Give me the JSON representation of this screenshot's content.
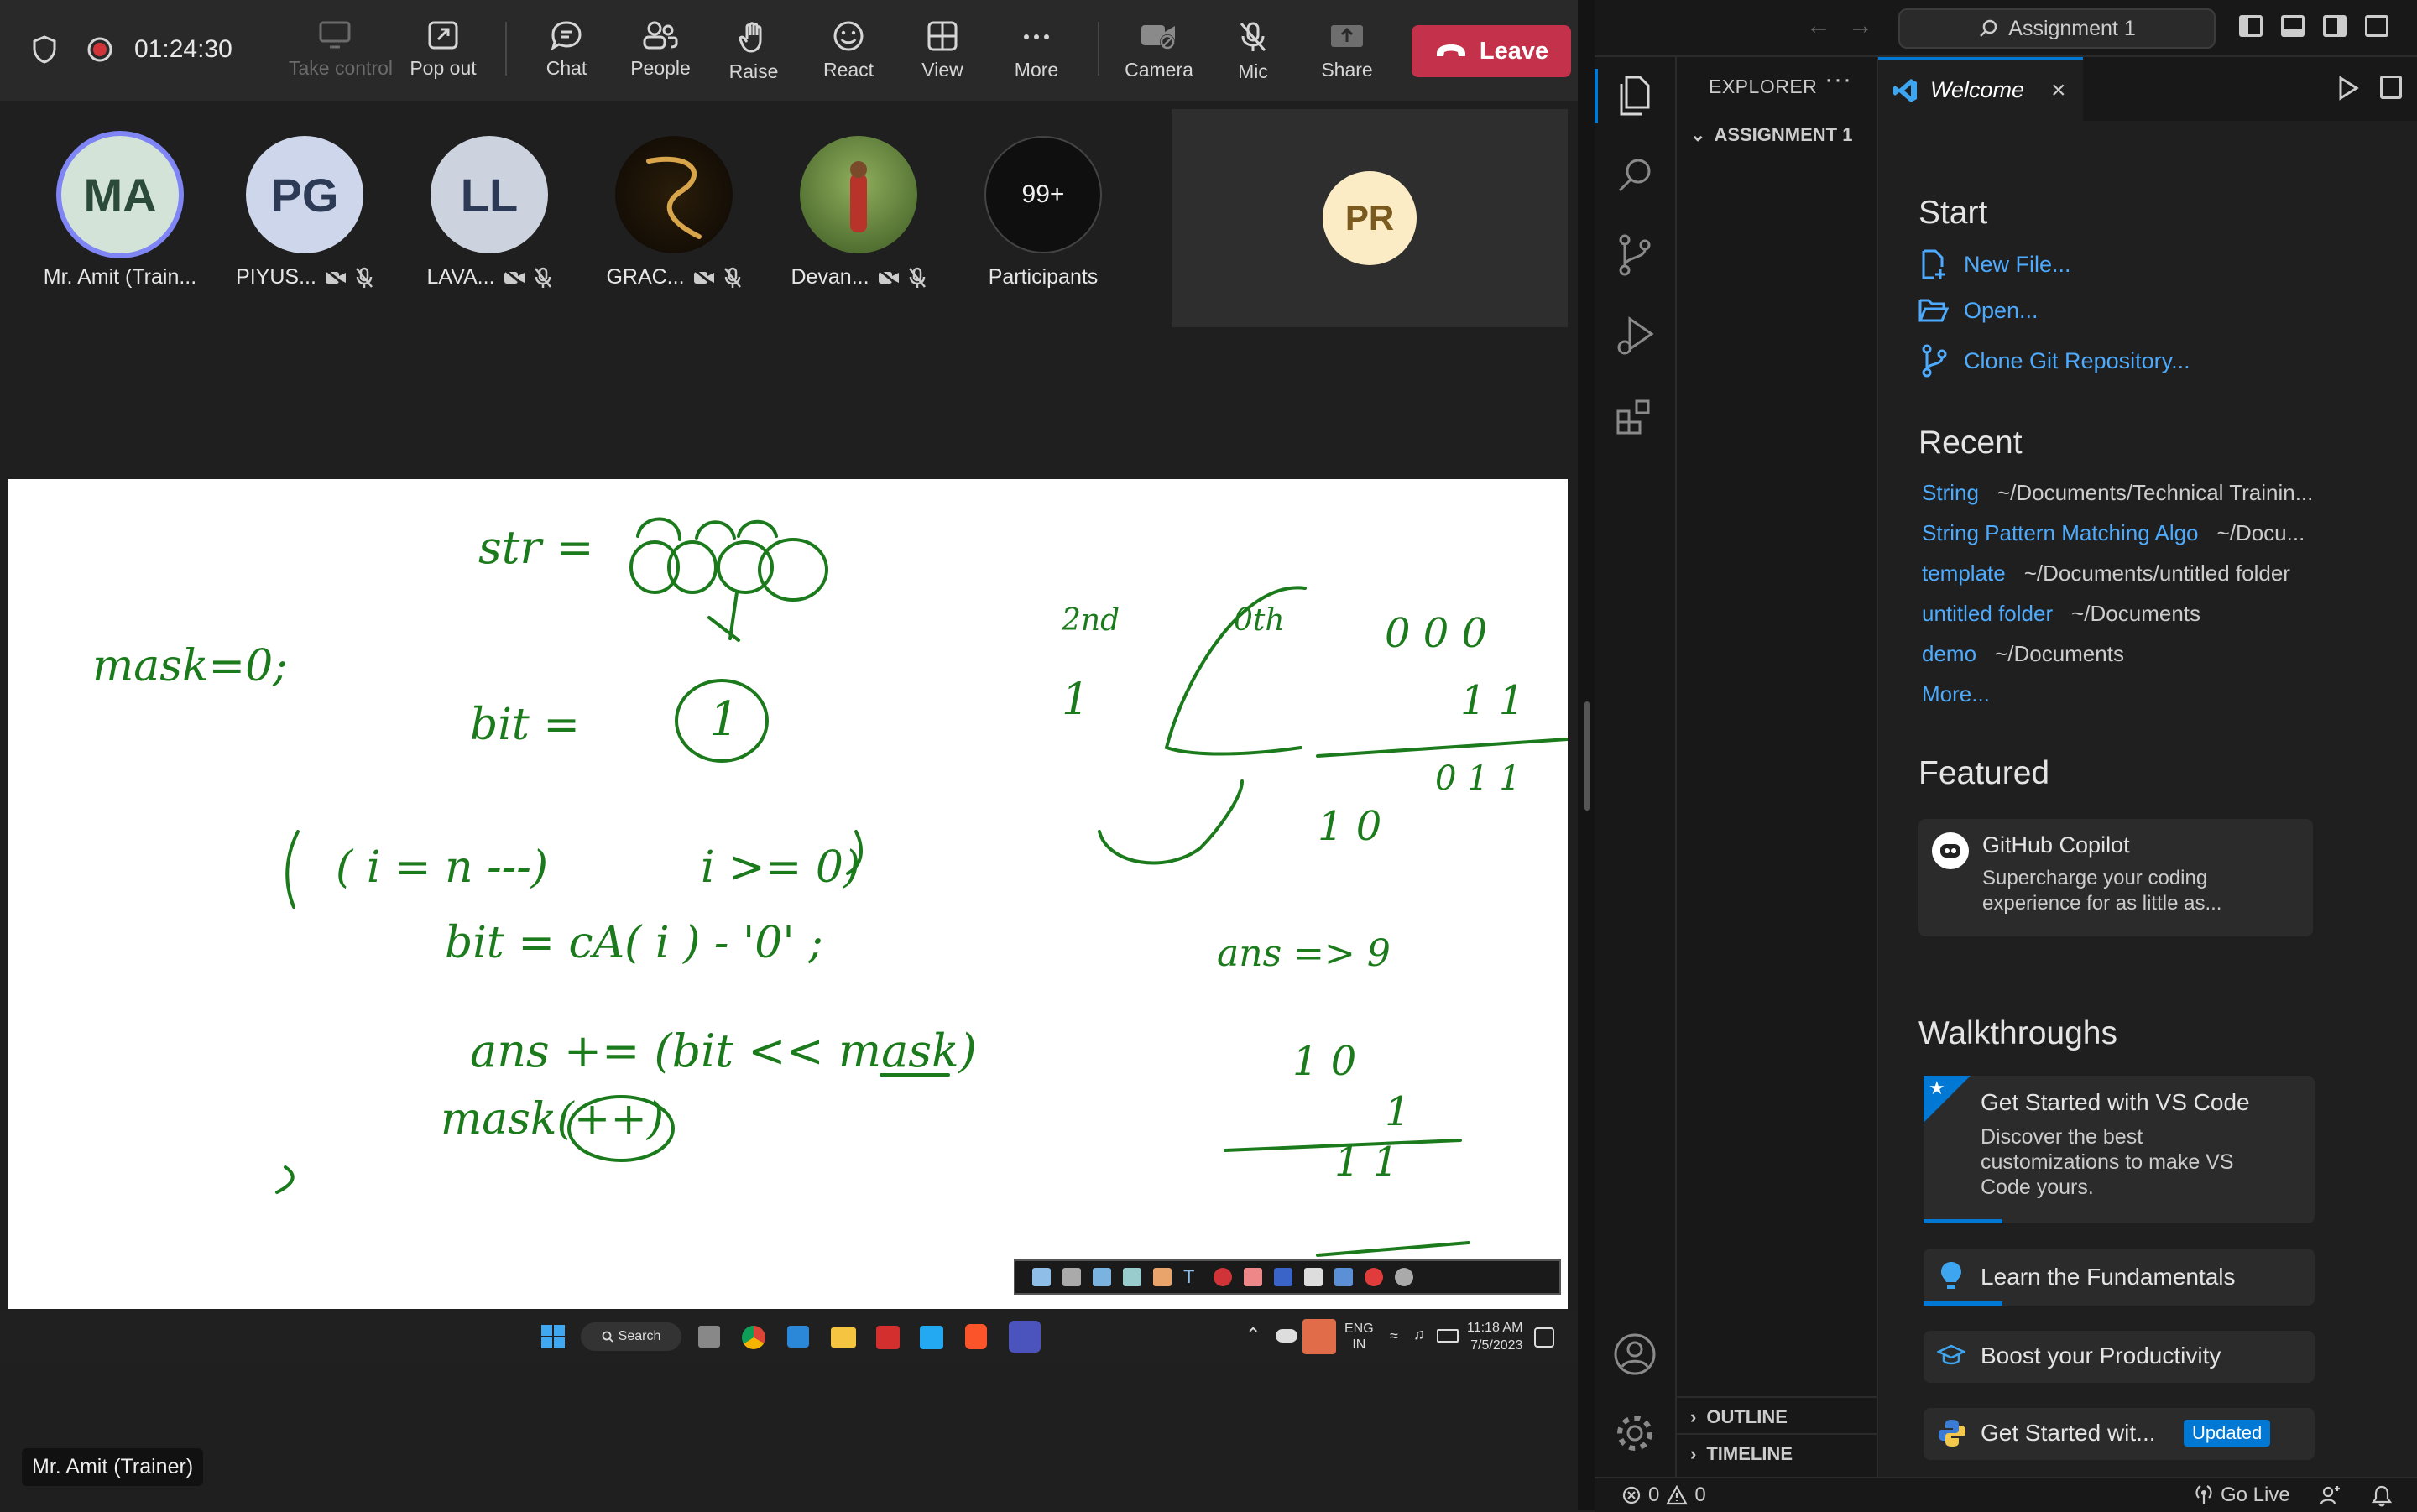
{
  "teams": {
    "timer": "01:24:30",
    "toolbar": [
      {
        "key": "take_control",
        "label": "Take control",
        "icon": "screen-share-icon",
        "disabled": true
      },
      {
        "key": "pop_out",
        "label": "Pop out",
        "icon": "pop-out-icon"
      },
      {
        "key": "chat",
        "label": "Chat",
        "icon": "chat-icon"
      },
      {
        "key": "people",
        "label": "People",
        "icon": "people-icon"
      },
      {
        "key": "raise",
        "label": "Raise",
        "icon": "raise-hand-icon"
      },
      {
        "key": "react",
        "label": "React",
        "icon": "smiley-icon"
      },
      {
        "key": "view",
        "label": "View",
        "icon": "grid-icon"
      },
      {
        "key": "more",
        "label": "More",
        "icon": "ellipsis-icon"
      },
      {
        "key": "camera",
        "label": "Camera",
        "icon": "camera-off-icon"
      },
      {
        "key": "mic",
        "label": "Mic",
        "icon": "mic-off-icon"
      },
      {
        "key": "share",
        "label": "Share",
        "icon": "share-tray-icon"
      }
    ],
    "leave_label": "Leave",
    "participants": [
      {
        "initials": "MA",
        "name": "Mr. Amit (Train...",
        "bg": "#d3e3d8"
      },
      {
        "initials": "PG",
        "name": "PIYUS...",
        "bg": "#cdd6ea"
      },
      {
        "initials": "LL",
        "name": "LAVA...",
        "bg": "#ccd3de"
      },
      {
        "initials": "",
        "name": "GRAC...",
        "bg": "#1a1208"
      },
      {
        "initials": "",
        "name": "Devan...",
        "bg": "#5d7a3a"
      }
    ],
    "more_count": "99+",
    "participants_label": "Participants",
    "pr_initials": "PR",
    "speaker_chip": "Mr. Amit (Trainer)",
    "whiteboard": {
      "str": "str =",
      "mask": "mask=0;",
      "bit": "bit =",
      "loop": "( i = n ---)",
      "cond": "i >= 0)",
      "bitline": "bit = cA( i ) - '0' ;",
      "ans": "ans += (bit << mask)",
      "maskpp": "mask(++)",
      "ans2": "ans => 9",
      "ten": "1 0",
      "one": "1",
      "eleven": "1 1",
      "ones": "1 1",
      "zeros": "0 0 0",
      "oneone": "0 1 1",
      "tenb": "1 0",
      "nd": "2nd",
      "th": "0th"
    },
    "taskbar": {
      "search": "Search",
      "lang": "ENG",
      "region": "IN",
      "time": "11:18 AM",
      "date": "7/5/2023"
    }
  },
  "vscode": {
    "search_box": "Assignment 1",
    "explorer_title": "EXPLORER",
    "folder": "ASSIGNMENT 1",
    "outline": "OUTLINE",
    "timeline": "TIMELINE",
    "tab_label": "Welcome",
    "start_title": "Start",
    "start_items": [
      "New File...",
      "Open...",
      "Clone Git Repository..."
    ],
    "recent_title": "Recent",
    "recent": [
      {
        "name": "String",
        "path": "~/Documents/Technical Trainin..."
      },
      {
        "name": "String Pattern Matching Algo",
        "path": "~/Docu..."
      },
      {
        "name": "template",
        "path": "~/Documents/untitled folder"
      },
      {
        "name": "untitled folder",
        "path": "~/Documents"
      },
      {
        "name": "demo",
        "path": "~/Documents"
      }
    ],
    "recent_more": "More...",
    "featured_title": "Featured",
    "copilot_title": "GitHub Copilot",
    "copilot_desc": "Supercharge your coding experience for as little as...",
    "walkthroughs_title": "Walkthroughs",
    "walkthroughs": [
      {
        "title": "Get Started with VS Code",
        "desc": "Discover the best customizations to make VS Code yours."
      },
      {
        "title": "Learn the Fundamentals"
      },
      {
        "title": "Boost your Productivity"
      },
      {
        "title": "Get Started wit...",
        "badge": "Updated"
      }
    ],
    "status": {
      "errors": "0",
      "warnings": "0",
      "golive": "Go Live"
    }
  }
}
